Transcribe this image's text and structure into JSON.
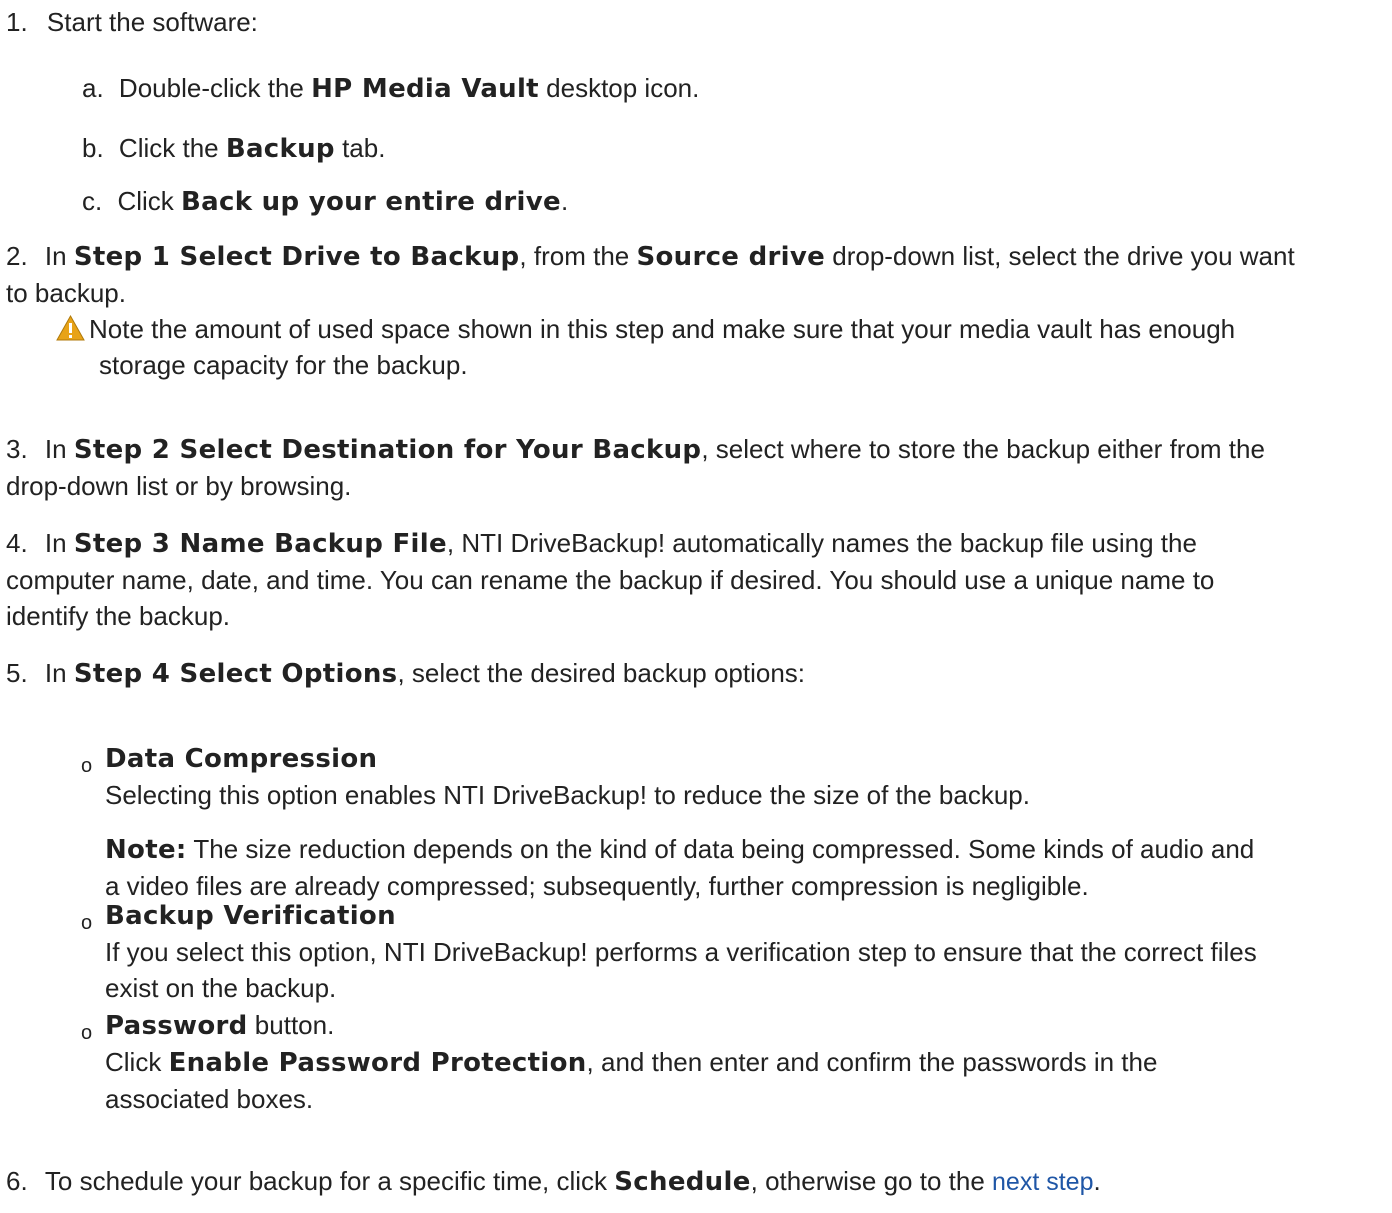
{
  "steps": {
    "s1": {
      "num": "1.",
      "text": "Start the software:"
    },
    "s1a": {
      "letter": "a.",
      "pre": "Double-click the ",
      "bold": "HP Media Vault",
      "post": " desktop icon."
    },
    "s1b": {
      "letter": "b.",
      "pre": "Click the ",
      "bold": "Backup",
      "post": " tab."
    },
    "s1c": {
      "letter": "c.",
      "pre": "Click ",
      "bold": "Back up your entire drive",
      "post": "."
    },
    "s2": {
      "num": "2.",
      "line1_pre": "In ",
      "bold1": "Step 1 Select Drive to Backup",
      "line1_mid": ", from the ",
      "bold2": "Source drive",
      "line1_post": " drop-down list, select the drive you want",
      "line2": "to backup.",
      "note_line1": "Note the amount of used space shown in this step and make sure that your media vault has enough",
      "note_line2": "storage capacity for the backup."
    },
    "s3": {
      "num": "3.",
      "pre": "In ",
      "bold": "Step 2 Select Destination for Your Backup",
      "post": ", select where to store the backup either from the",
      "line2": "drop-down list or by browsing."
    },
    "s4": {
      "num": "4.",
      "pre": "In ",
      "bold": "Step 3 Name Backup File",
      "post": ", NTI DriveBackup! automatically names the backup file using the",
      "line2": "computer name, date, and time. You can rename the backup if desired. You should use a unique name to",
      "line3": "identify the backup."
    },
    "s5": {
      "num": "5.",
      "pre": "In ",
      "bold": "Step 4 Select Options",
      "post": ", select the desired backup options:"
    },
    "opt1": {
      "title": "Data Compression",
      "desc": "Selecting this option enables NTI DriveBackup! to reduce the size of the backup.",
      "note_bold": "Note:",
      "note_line1": " The size reduction depends on the kind of data being compressed. Some kinds of audio and",
      "note_line2": "a video files are already compressed; subsequently, further compression is negligible."
    },
    "opt2": {
      "title": "Backup Verification",
      "line1": "If you select this option, NTI DriveBackup! performs a verification step to ensure that the correct files",
      "line2": "exist on the backup."
    },
    "opt3": {
      "title": "Password",
      "title_post": " button.",
      "pre": "Click ",
      "bold": "Enable Password Protection",
      "post": ", and then enter and confirm the passwords in the",
      "line2": "associated boxes."
    },
    "s6": {
      "num": "6.",
      "pre": "To schedule your backup for a specific time, click ",
      "bold": "Schedule",
      "mid": ", otherwise go to the ",
      "link": "next step",
      "post": "."
    }
  },
  "bullet_glyph": "o",
  "colors": {
    "text": "#222222",
    "link": "#1f56a6",
    "warning": "#e8a317"
  }
}
